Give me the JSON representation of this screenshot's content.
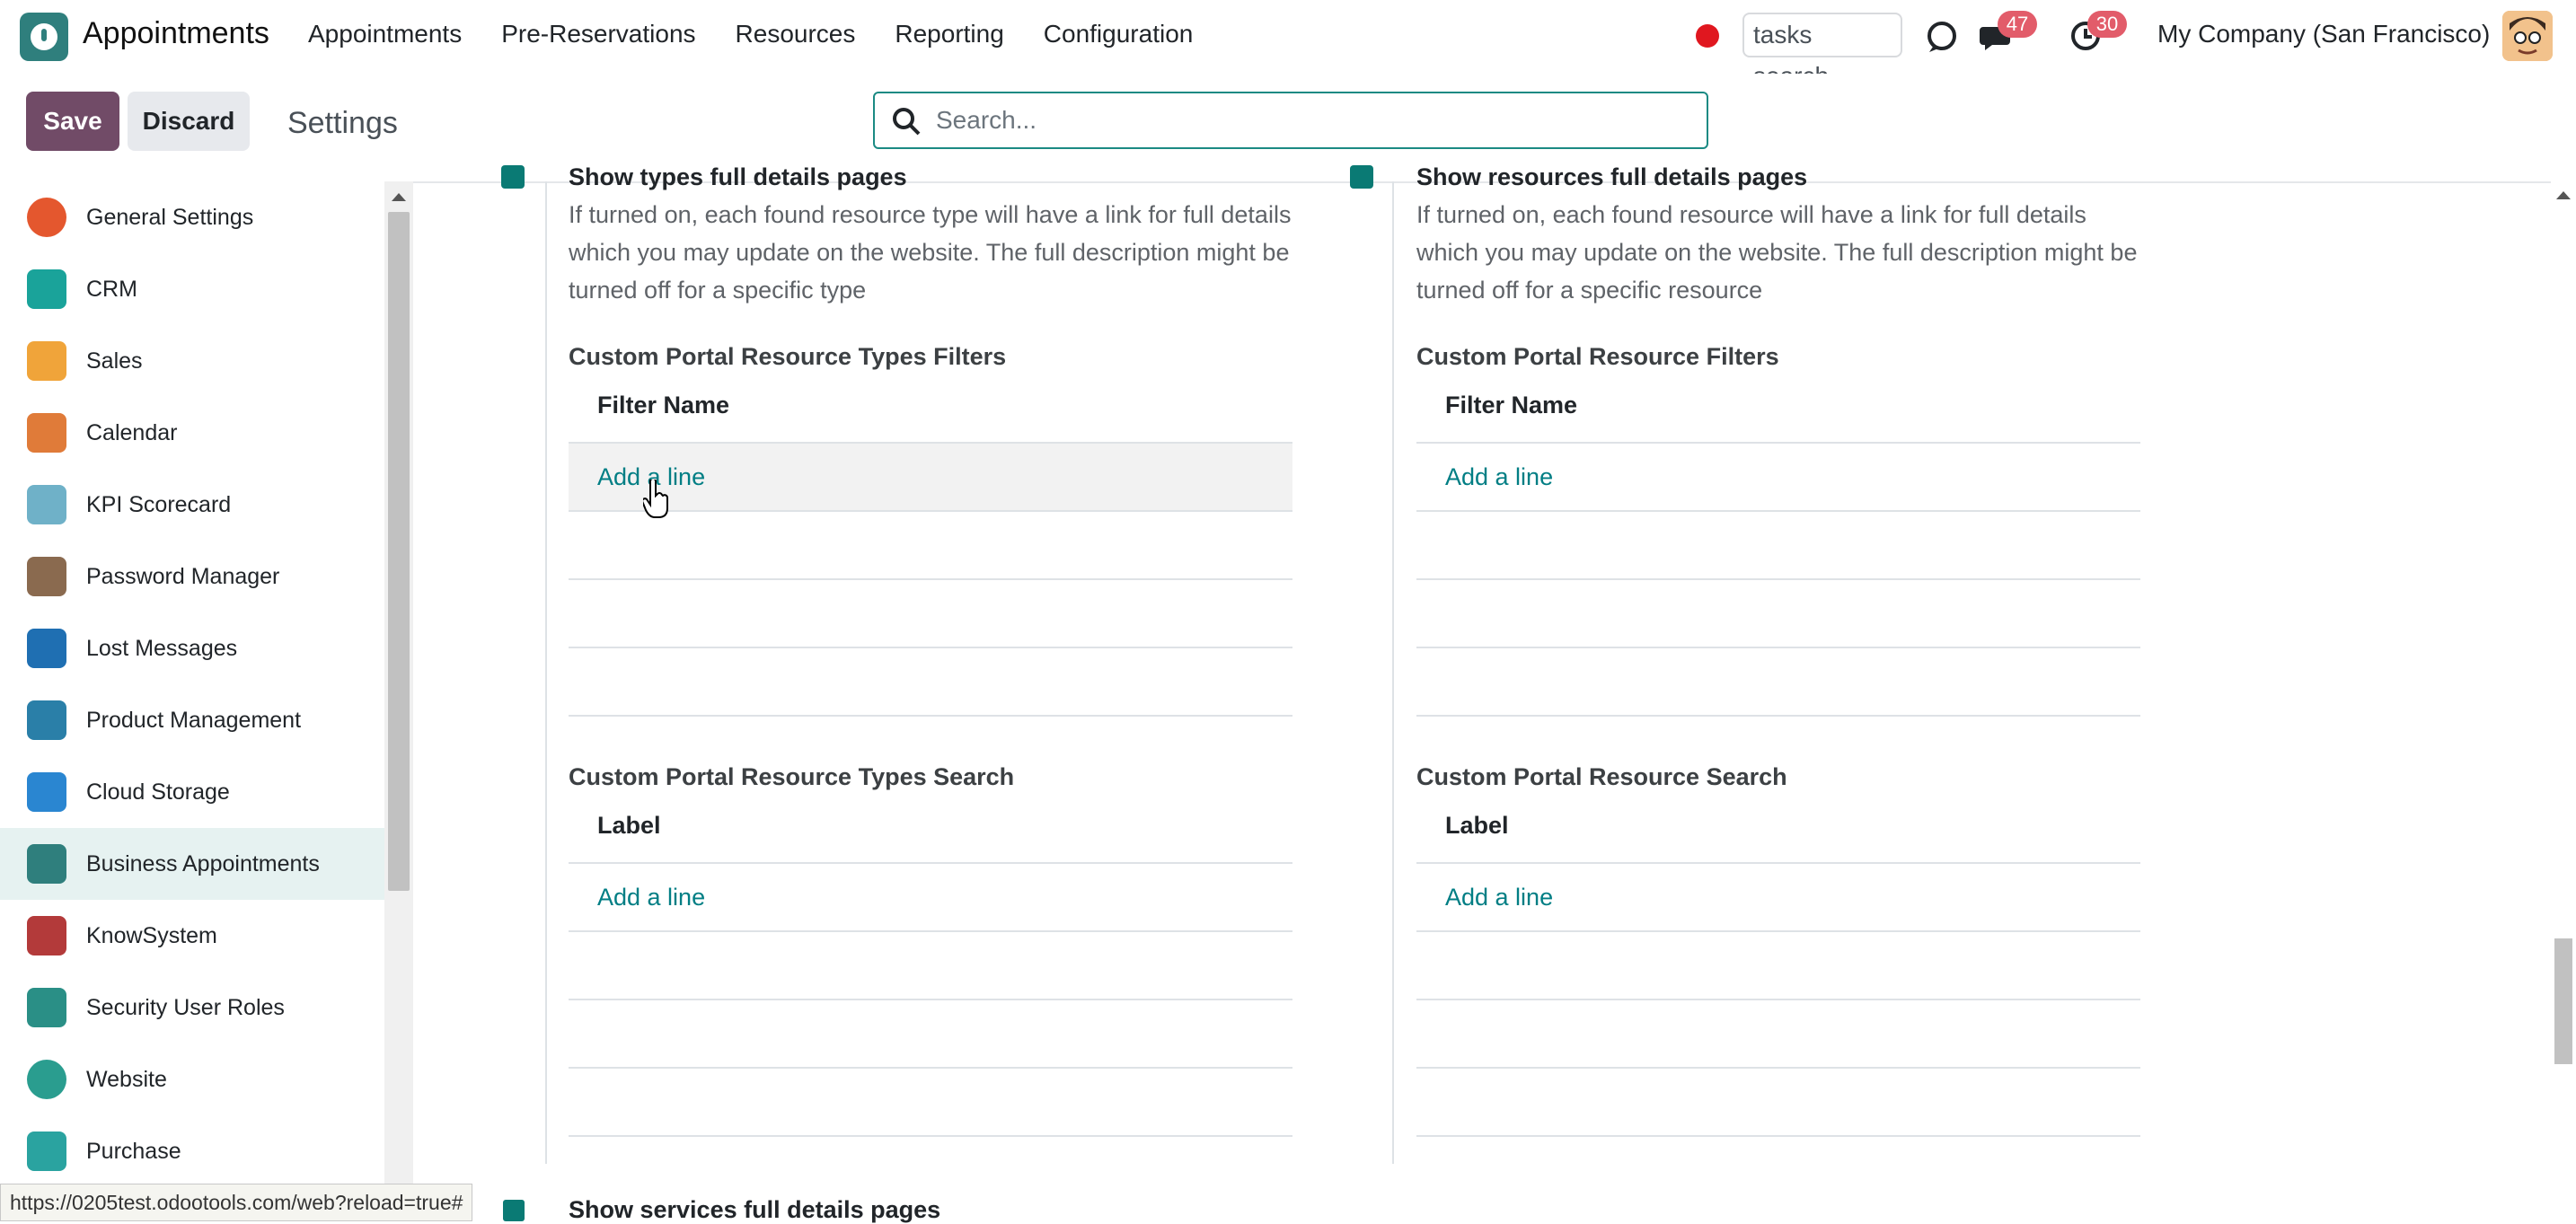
{
  "app": {
    "name": "Appointments"
  },
  "menu": [
    "Appointments",
    "Pre-Reservations",
    "Resources",
    "Reporting",
    "Configuration"
  ],
  "systray": {
    "tasks_search_placeholder": "tasks search",
    "messages_count": "47",
    "activities_count": "30",
    "company": "My Company (San Francisco)"
  },
  "control": {
    "save_label": "Save",
    "discard_label": "Discard",
    "title": "Settings",
    "search_placeholder": "Search..."
  },
  "sidebar": {
    "active": "Business Appointments",
    "items": [
      {
        "label": "General Settings",
        "icon": "general-settings-icon",
        "color": "#e4572e"
      },
      {
        "label": "CRM",
        "icon": "crm-icon",
        "color": "#1aa39a"
      },
      {
        "label": "Sales",
        "icon": "sales-icon",
        "color": "#f0a43a"
      },
      {
        "label": "Calendar",
        "icon": "calendar-icon",
        "color": "#e07b39"
      },
      {
        "label": "KPI Scorecard",
        "icon": "kpi-scorecard-icon",
        "color": "#6fb1c8"
      },
      {
        "label": "Password Manager",
        "icon": "password-manager-icon",
        "color": "#8a6a4f"
      },
      {
        "label": "Lost Messages",
        "icon": "lost-messages-icon",
        "color": "#1f6fb2"
      },
      {
        "label": "Product Management",
        "icon": "product-management-icon",
        "color": "#2a7fa8"
      },
      {
        "label": "Cloud Storage",
        "icon": "cloud-storage-icon",
        "color": "#2a86d1"
      },
      {
        "label": "Business Appointments",
        "icon": "business-appointments-icon",
        "color": "#2f7f7d"
      },
      {
        "label": "KnowSystem",
        "icon": "knowsystem-icon",
        "color": "#b33a3a"
      },
      {
        "label": "Security User Roles",
        "icon": "security-user-roles-icon",
        "color": "#2a8f86"
      },
      {
        "label": "Website",
        "icon": "website-icon",
        "color": "#2a9d8f"
      },
      {
        "label": "Purchase",
        "icon": "purchase-icon",
        "color": "#2aa3a0"
      }
    ]
  },
  "left_column": {
    "heading": "Show types full details pages",
    "description": "If turned on, each found resource type will have a link for full details which you may update on the website. The full description might be turned off for a specific type",
    "filters_title": "Custom Portal Resource Types Filters",
    "filters_header": "Filter Name",
    "search_title": "Custom Portal Resource Types Search",
    "search_header": "Label",
    "add_line": "Add a line"
  },
  "right_column": {
    "heading": "Show resources full details pages",
    "description": "If turned on, each found resource will have a link for full details which you may update on the website. The full description might be turned off for a specific resource",
    "filters_title": "Custom Portal Resource Filters",
    "filters_header": "Filter Name",
    "search_title": "Custom Portal Resource Search",
    "search_header": "Label",
    "add_line": "Add a line"
  },
  "bottom": {
    "status_url": "https://0205test.odootools.com/web?reload=true#",
    "next_setting_label": "Show services full details pages"
  }
}
